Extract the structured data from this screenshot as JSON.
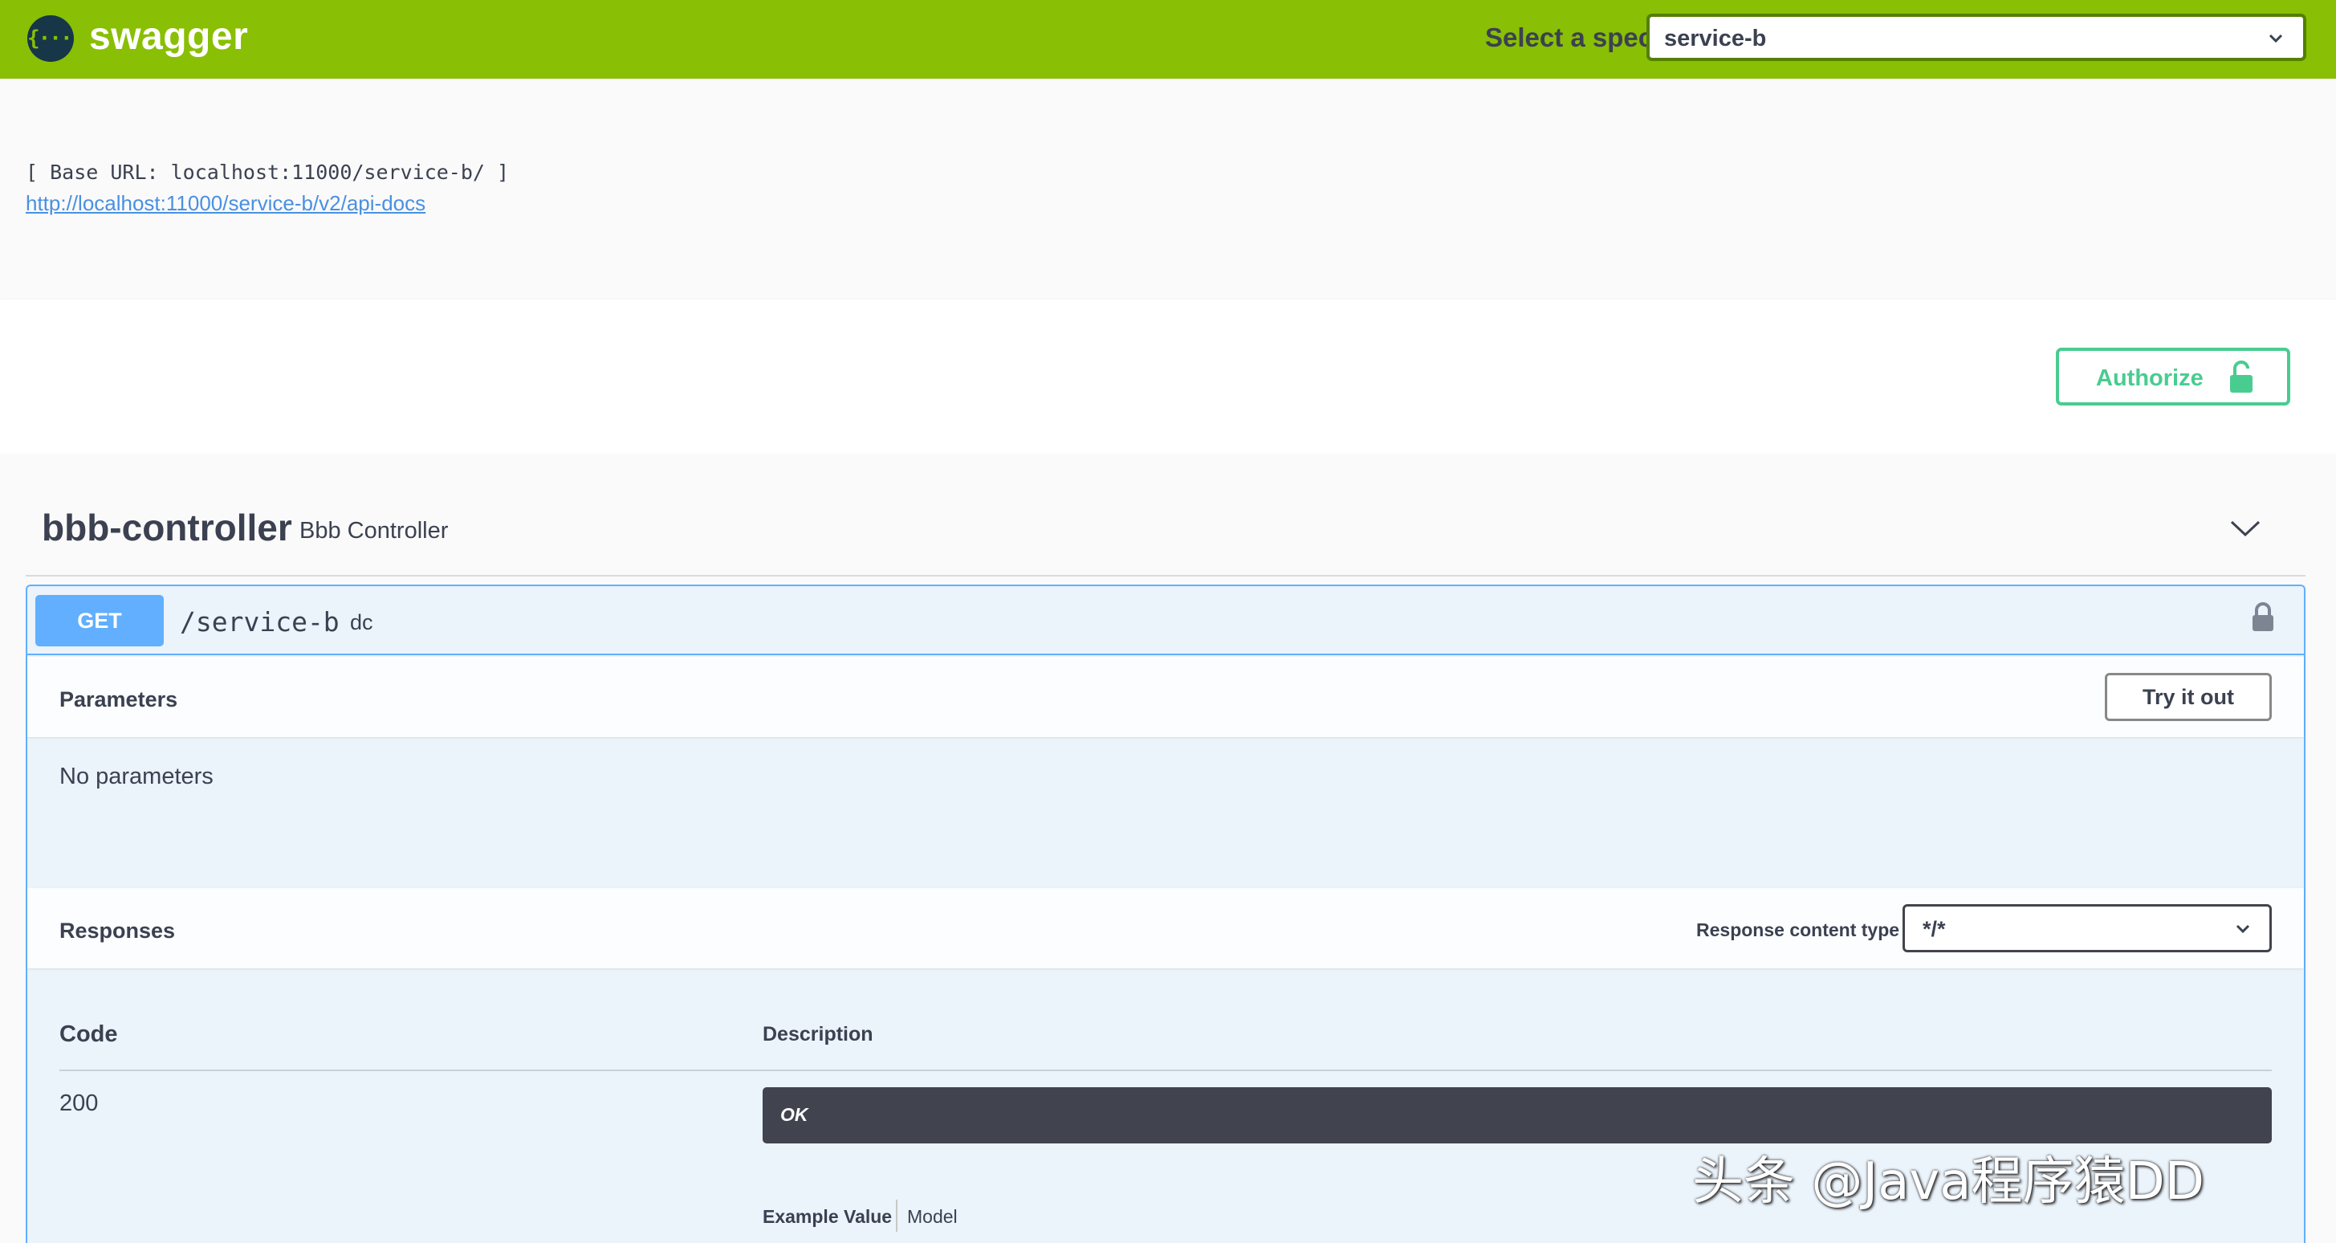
{
  "topbar": {
    "logo_glyph": "{···}",
    "brand": "swagger",
    "spec_label": "Select a spec",
    "spec_value": "service-b",
    "color": "#89bf04"
  },
  "info": {
    "base_url": "[ Base URL: localhost:11000/service-b/ ]",
    "docs_link": "http://localhost:11000/service-b/v2/api-docs"
  },
  "auth": {
    "authorize_label": "Authorize",
    "accent": "#49cc90"
  },
  "tag": {
    "name": "bbb-controller",
    "description": "Bbb Controller"
  },
  "operation": {
    "method": "GET",
    "path": "/service-b",
    "summary": "dc",
    "method_color": "#61affe",
    "parameters_title": "Parameters",
    "try_it_out": "Try it out",
    "no_parameters": "No parameters",
    "responses_title": "Responses",
    "response_content_type_label": "Response content type",
    "response_content_type_value": "*/*",
    "table": {
      "col_code": "Code",
      "col_description": "Description",
      "rows": [
        {
          "code": "200",
          "description": "OK"
        }
      ]
    },
    "example_value_tab": "Example Value",
    "model_tab": "Model"
  },
  "watermark": "头条 @Java程序猿DD"
}
